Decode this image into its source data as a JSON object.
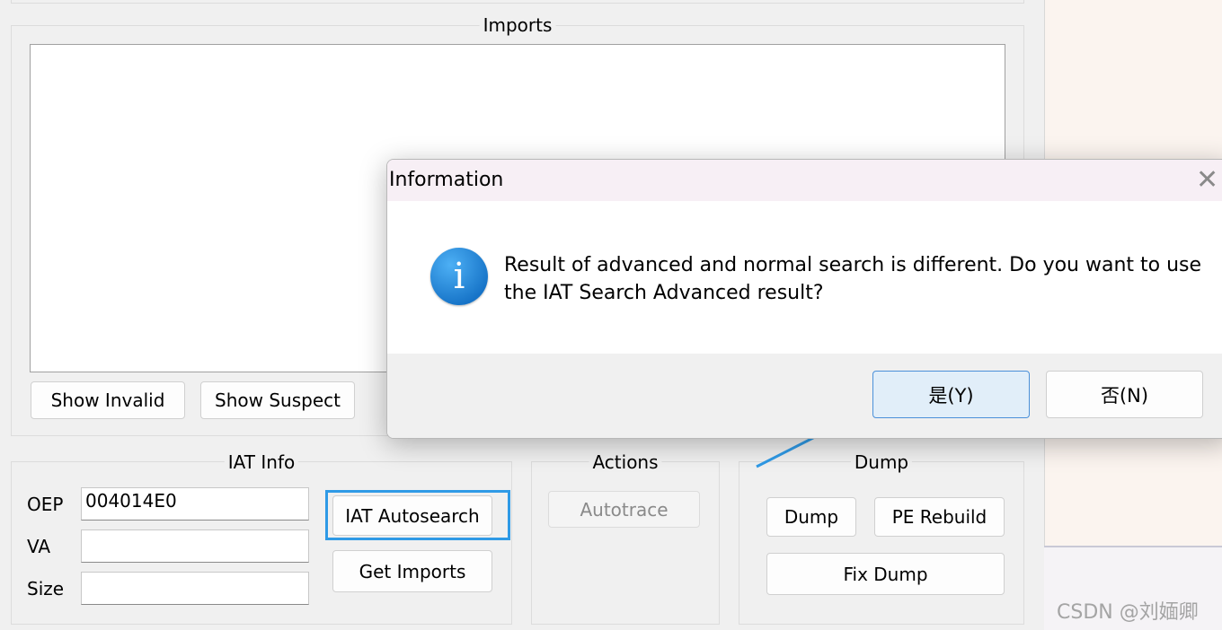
{
  "imports": {
    "title": "Imports",
    "show_invalid": "Show Invalid",
    "show_suspect": "Show Suspect"
  },
  "iat_info": {
    "title": "IAT Info",
    "oep_label": "OEP",
    "oep_value": "004014E0",
    "va_label": "VA",
    "va_value": "",
    "size_label": "Size",
    "size_value": "",
    "autosearch": "IAT Autosearch",
    "get_imports": "Get Imports"
  },
  "actions": {
    "title": "Actions",
    "autotrace": "Autotrace"
  },
  "dump": {
    "title": "Dump",
    "dump": "Dump",
    "pe_rebuild": "PE Rebuild",
    "fix_dump": "Fix Dump"
  },
  "dialog": {
    "title": "Information",
    "close_icon": "close-icon",
    "icon": "info-icon",
    "message": "Result of advanced and normal search is different. Do you want to use the IAT Search Advanced result?",
    "yes": "是(Y)",
    "no": "否(N)"
  },
  "watermark": "CSDN @刘媔卿",
  "colors": {
    "highlight": "#2f9ae6",
    "arrow": "#2f9ae6",
    "yes_button": "#e1eef9"
  }
}
